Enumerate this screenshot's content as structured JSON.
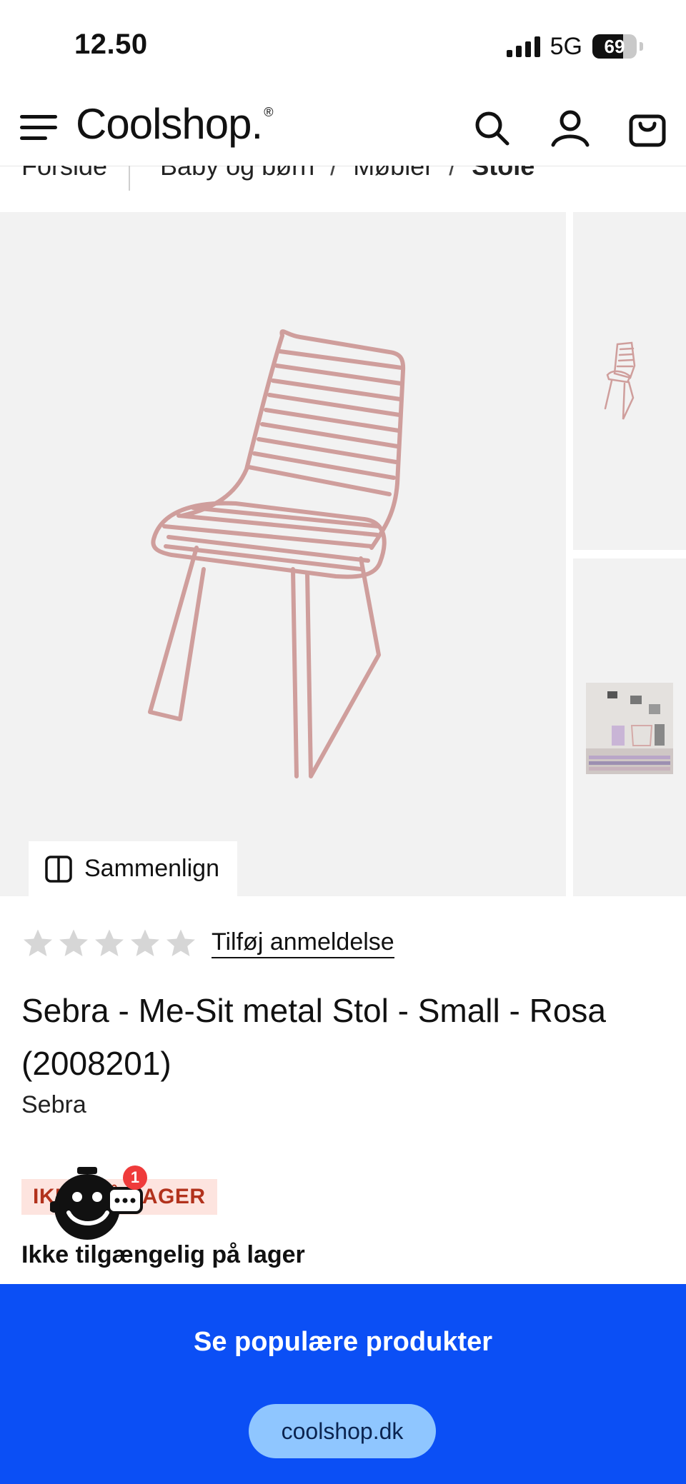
{
  "status_bar": {
    "time": "12.50",
    "network": "5G",
    "battery": "69",
    "battery_level": 0.69,
    "signal_bars": 4
  },
  "header": {
    "logo": "Coolshop.",
    "logo_mark": "®",
    "icons": [
      "menu-icon",
      "search-icon",
      "user-icon",
      "cart-icon"
    ]
  },
  "breadcrumb": {
    "items": [
      "Forside",
      "Baby og børn",
      "Møbler",
      "Stole"
    ],
    "separator": "/"
  },
  "gallery": {
    "compare_label": "Sammenlign"
  },
  "rating": {
    "stars_filled": 0,
    "stars_total": 5,
    "review_link": "Tilføj anmeldelse"
  },
  "product": {
    "title": "Sebra - Me-Sit metal Stol - Small - Rosa (2008201)",
    "brand": "Sebra"
  },
  "stock": {
    "badge": "IKKE PÅ LAGER",
    "text": "Ikke tilgængelig på lager"
  },
  "chat": {
    "badge_count": "1"
  },
  "cta": {
    "title": "Se populære produkter",
    "url": "coolshop.dk"
  },
  "colors": {
    "accent_blue": "#0b4ff5",
    "stock_bg": "#fde4df",
    "stock_text": "#b2321c",
    "chair_pink": "#cf9e9c",
    "star_gray": "#d6d6d6"
  }
}
